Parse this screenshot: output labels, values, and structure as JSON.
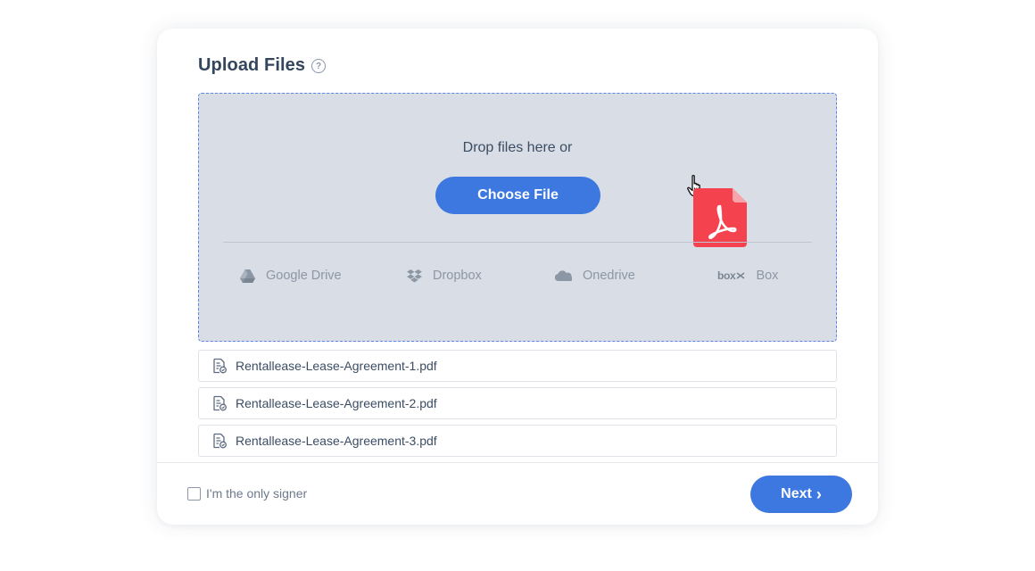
{
  "header": {
    "title": "Upload Files",
    "help_icon": "question-circle-icon",
    "help_glyph": "?"
  },
  "dropzone": {
    "prompt": "Drop files here or",
    "choose_label": "Choose File",
    "sources": [
      {
        "label": "Google Drive",
        "icon": "google-drive-icon"
      },
      {
        "label": "Dropbox",
        "icon": "dropbox-icon"
      },
      {
        "label": "Onedrive",
        "icon": "onedrive-icon"
      },
      {
        "label": "Box",
        "icon": "box-logo-icon",
        "logo_text": "box"
      }
    ],
    "dragged_file_icon": "pdf-file-icon"
  },
  "files": [
    {
      "name": "Rentallease-Lease-Agreement-1.pdf",
      "icon": "document-icon"
    },
    {
      "name": "Rentallease-Lease-Agreement-2.pdf",
      "icon": "document-icon"
    },
    {
      "name": "Rentallease-Lease-Agreement-3.pdf",
      "icon": "document-icon"
    }
  ],
  "footer": {
    "only_signer_label": "I'm the only signer",
    "only_signer_checked": false,
    "next_label": "Next",
    "next_glyph": "›"
  },
  "colors": {
    "accent": "#3c78e0",
    "dropzone_bg": "#d9dde5",
    "dropzone_border": "#5d85e6",
    "pdf_red": "#f5424f",
    "title": "#33465e"
  }
}
